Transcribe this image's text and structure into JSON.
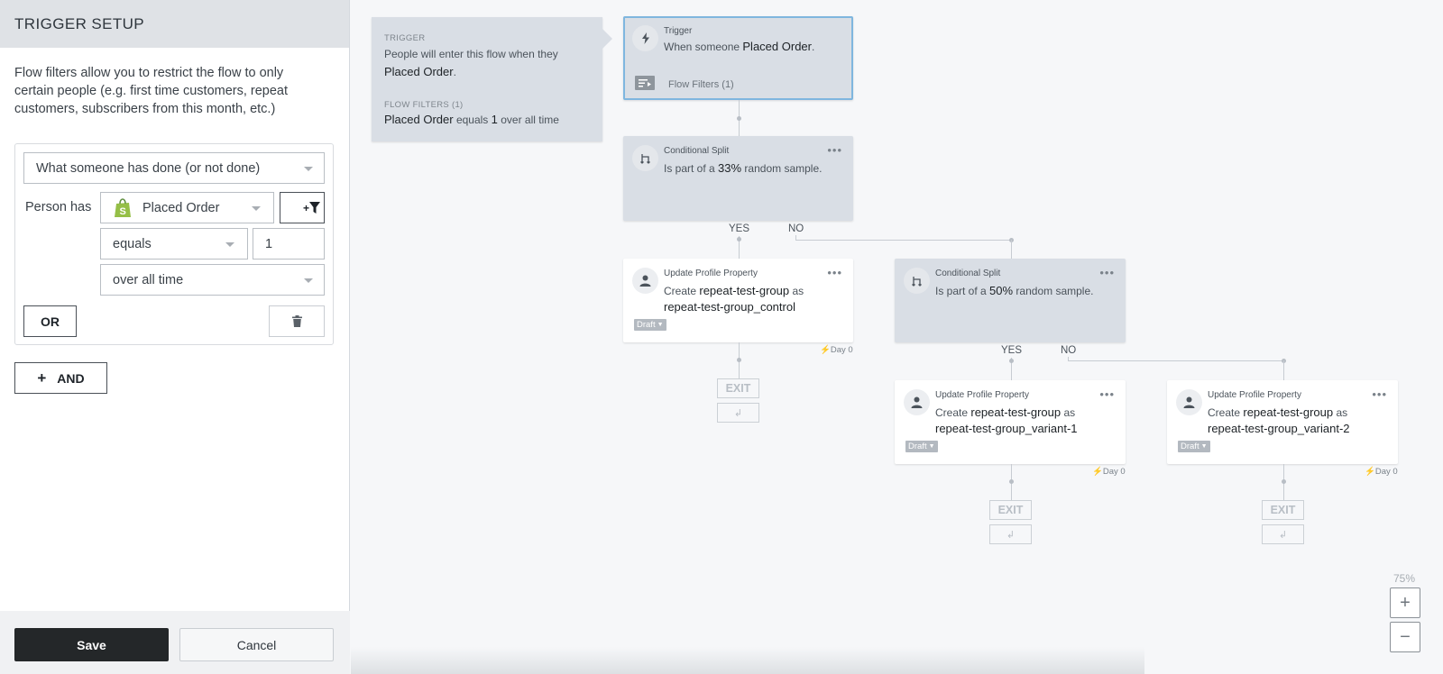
{
  "sidebar": {
    "title": "TRIGGER SETUP",
    "description": "Flow filters allow you to restrict the flow to only certain people (e.g. first time customers, repeat customers, subscribers from this month, etc.)",
    "condition_type": "What someone has done (or not done)",
    "person_has_label": "Person has",
    "metric": "Placed Order",
    "metric_source_icon": "shopify-icon",
    "add_filter_icon": "plus-filter-icon",
    "operator": "equals",
    "value": "1",
    "timeframe": "over all time",
    "or_label": "OR",
    "delete_icon": "trash-icon",
    "and_label": "AND",
    "and_icon": "+",
    "save_label": "Save",
    "cancel_label": "Cancel"
  },
  "info_panel": {
    "trigger_heading": "TRIGGER",
    "trigger_text": "People will enter this flow when they",
    "trigger_metric": "Placed Order",
    "period": ".",
    "filters_heading": "FLOW FILTERS (1)",
    "filter_metric": "Placed Order",
    "filter_op": "equals",
    "filter_value": "1",
    "filter_time": "over all time"
  },
  "flow": {
    "trigger": {
      "title": "Trigger",
      "prefix": "When someone",
      "metric": "Placed Order",
      "suffix": ".",
      "filters_label": "Flow Filters (1)"
    },
    "split1": {
      "title": "Conditional Split",
      "prefix": "Is part of a",
      "percent": "33%",
      "suffix": "random sample.",
      "menu": "•••",
      "yes": "YES",
      "no": "NO"
    },
    "control": {
      "title": "Update Profile Property",
      "create": "Create",
      "property": "repeat-test-group",
      "as": "as",
      "value": "repeat-test-group_control",
      "status": "Draft",
      "day": "Day 0",
      "menu": "•••"
    },
    "split2": {
      "title": "Conditional Split",
      "prefix": "Is part of a",
      "percent": "50%",
      "suffix": "random sample.",
      "menu": "•••",
      "yes": "YES",
      "no": "NO"
    },
    "variant1": {
      "title": "Update Profile Property",
      "create": "Create",
      "property": "repeat-test-group",
      "as": "as",
      "value": "repeat-test-group_variant-1",
      "status": "Draft",
      "day": "Day 0",
      "menu": "•••"
    },
    "variant2": {
      "title": "Update Profile Property",
      "create": "Create",
      "property": "repeat-test-group",
      "as": "as",
      "value": "repeat-test-group_variant-2",
      "status": "Draft",
      "day": "Day 0",
      "menu": "•••"
    },
    "exit_label": "EXIT"
  },
  "zoom": {
    "level": "75%",
    "plus": "+",
    "minus": "−"
  }
}
